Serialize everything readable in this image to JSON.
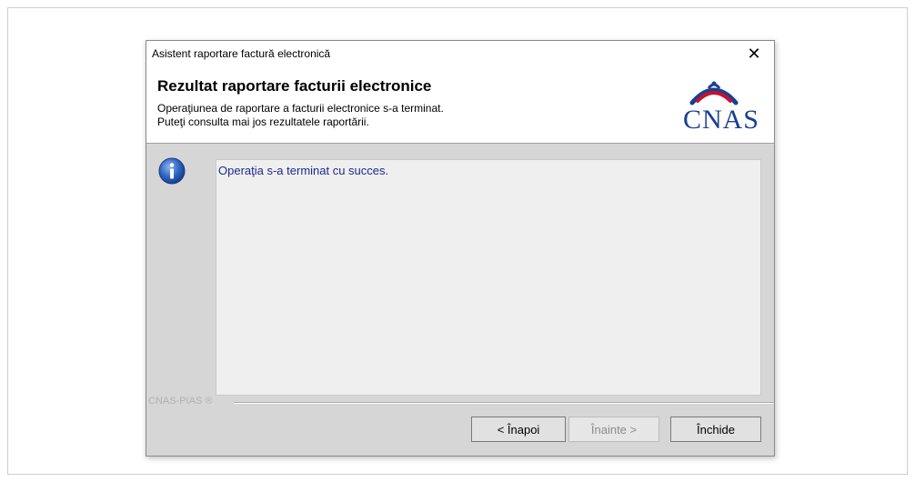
{
  "window": {
    "title": "Asistent raportare factură electronică",
    "close_symbol": "✕"
  },
  "header": {
    "title": "Rezultat raportare facturii electronice",
    "description_line1": "Operaţiunea de raportare a facturii electronice s-a terminat.",
    "description_line2": "Puteţi consulta mai jos rezultatele raportării.",
    "logo_text": "CNAS"
  },
  "content": {
    "icon": "info-icon",
    "message": "Operaţia s-a terminat cu succes."
  },
  "footer": {
    "brand": "CNAS-PIAS ®",
    "buttons": {
      "back": "< Înapoi",
      "next": "Înainte >",
      "close": "Închide"
    }
  },
  "colors": {
    "logo_blue": "#1a3f8f",
    "message_text": "#1f2a8a",
    "content_bg": "#d6d6d6"
  }
}
